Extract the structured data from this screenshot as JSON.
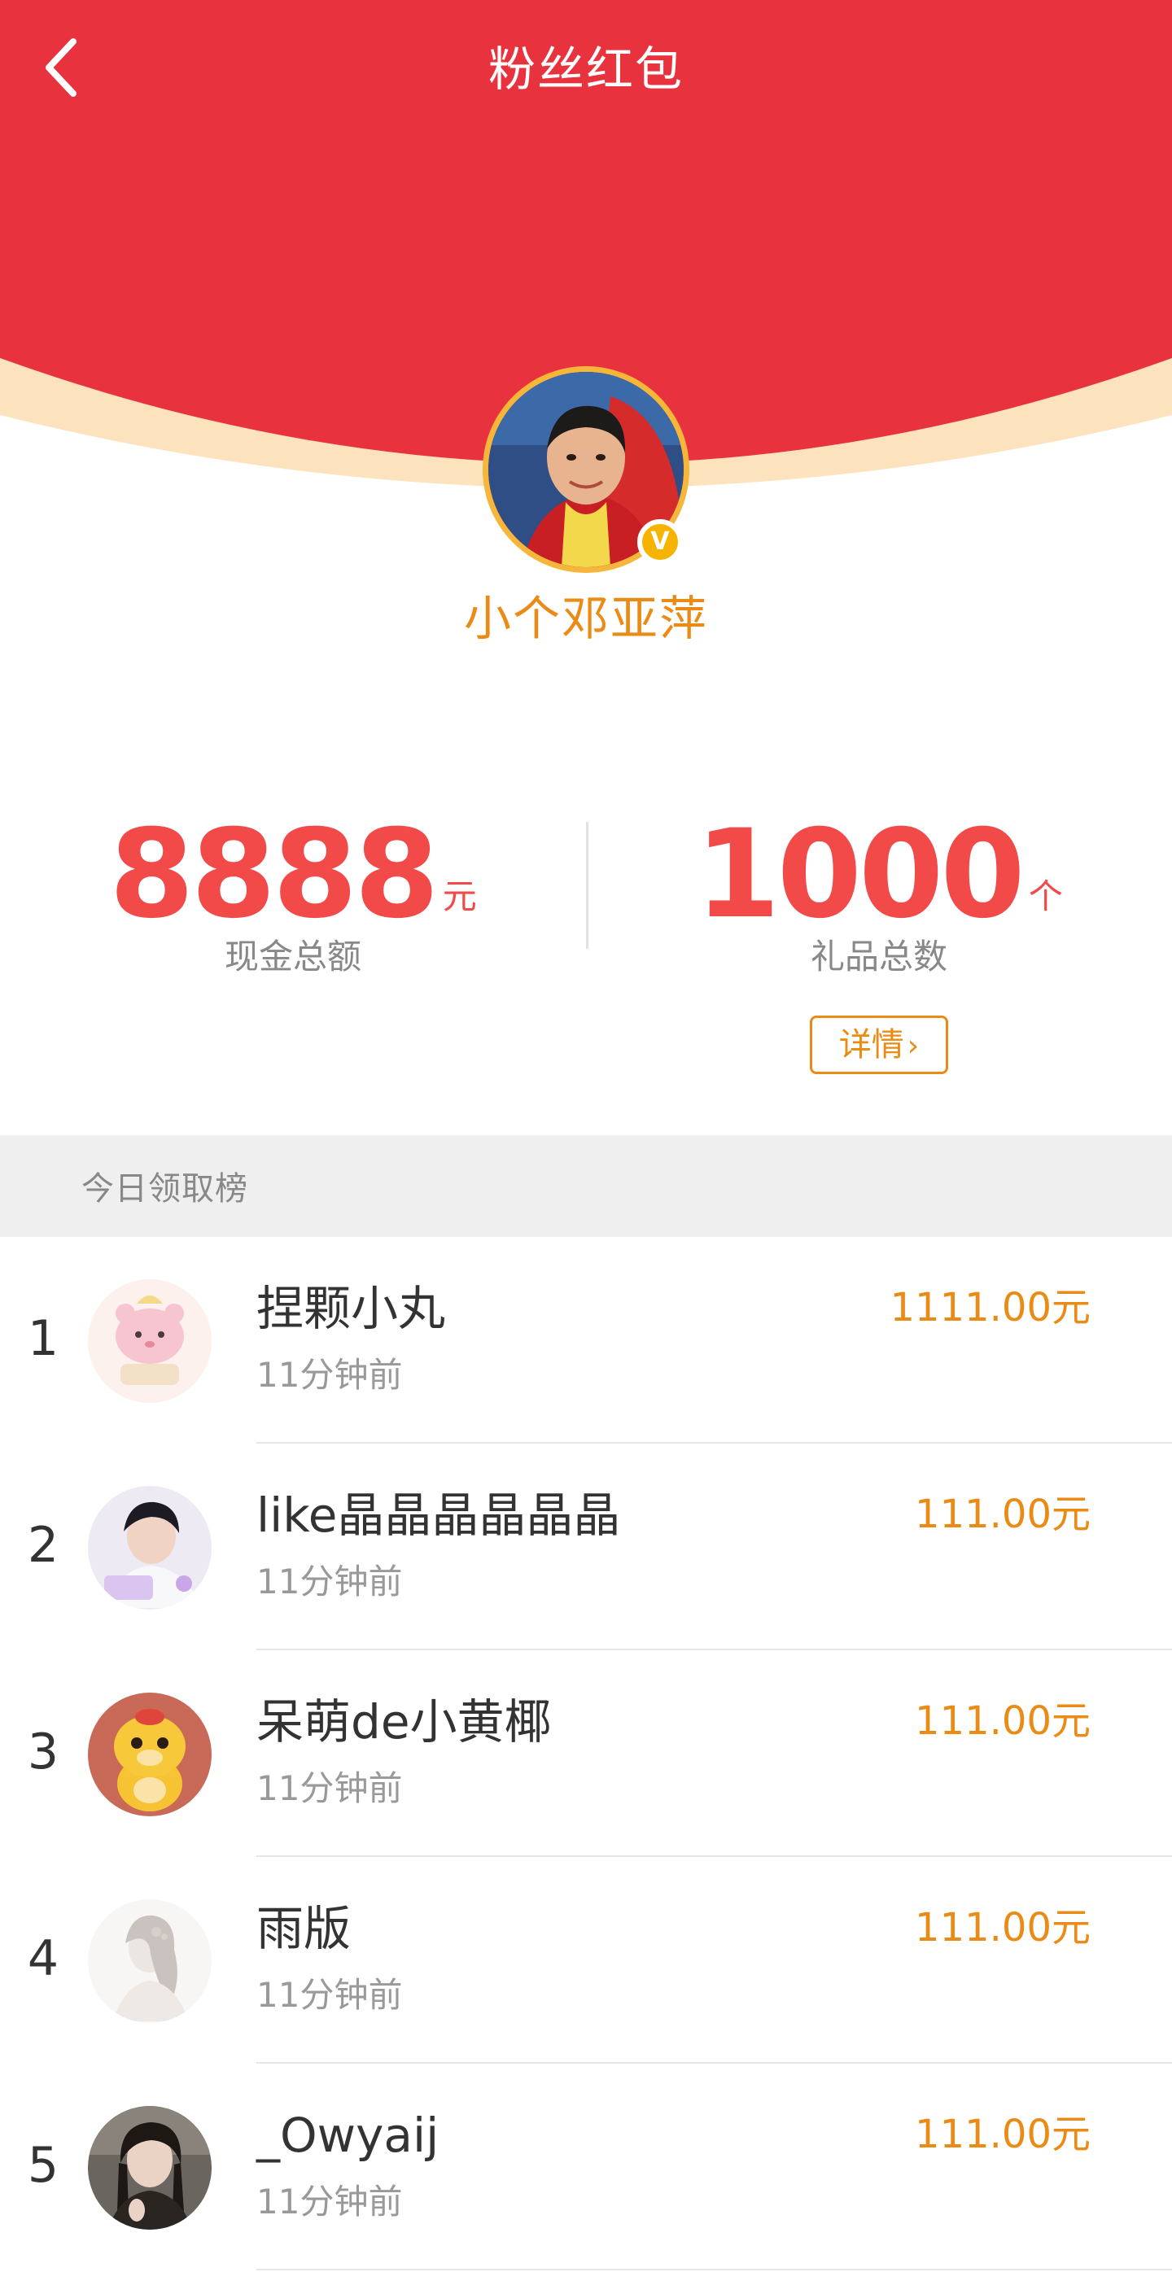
{
  "header": {
    "title": "粉丝红包",
    "back_icon": "chevron-left-icon",
    "background_color": "#e8333e",
    "arc_color": "#fde3bd"
  },
  "profile": {
    "name": "小个邓亚萍",
    "verified_badge": "V"
  },
  "stats": {
    "cash": {
      "value": "8888",
      "unit": "元",
      "label": "现金总额"
    },
    "gifts": {
      "value": "1000",
      "unit": "个",
      "label": "礼品总数"
    },
    "detail_button": {
      "label": "详情",
      "icon": "chevron-right-icon"
    }
  },
  "section": {
    "title": "今日领取榜"
  },
  "leaderboard": [
    {
      "rank": "1",
      "name": "捏颗小丸",
      "time": "11分钟前",
      "amount": "1111.00元"
    },
    {
      "rank": "2",
      "name": "like晶晶晶晶晶晶",
      "time": "11分钟前",
      "amount": "111.00元"
    },
    {
      "rank": "3",
      "name": "呆萌de小黄椰",
      "time": "11分钟前",
      "amount": "111.00元"
    },
    {
      "rank": "4",
      "name": "雨版",
      "time": "11分钟前",
      "amount": "111.00元"
    },
    {
      "rank": "5",
      "name": "_Owyaij",
      "time": "11分钟前",
      "amount": "111.00元"
    }
  ],
  "colors": {
    "accent_orange": "#ea8b16",
    "stat_red": "#f24949",
    "avatar_ring": "#f5b63a"
  }
}
